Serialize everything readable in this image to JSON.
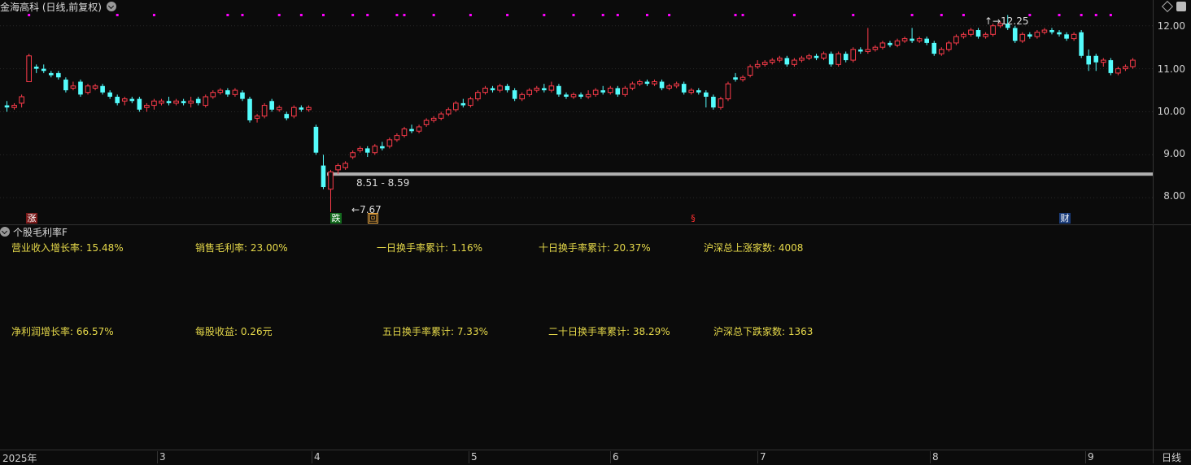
{
  "header": {
    "title": "金海高科 (日线,前复权)"
  },
  "price_axis": {
    "ticks": [
      "12.00",
      "11.00",
      "10.00",
      "9.00",
      "8.00"
    ]
  },
  "annotations": {
    "high_label": "12.25",
    "low_label": "7.67",
    "range_label": "8.51 - 8.59"
  },
  "markers": {
    "m1": "涨",
    "m2": "跌",
    "m3": "回",
    "m4": "§",
    "m5": "财"
  },
  "indicator": {
    "title": "个股毛利率F",
    "row1": [
      "营业收入增长率:  15.48%",
      "销售毛利率: 23.00%",
      "一日换手率累计: 1.16%",
      "十日换手率累计: 20.37%",
      "沪深总上涨家数:  4008"
    ],
    "row2": [
      "净利润增长率:  66.57%",
      "每股收益: 0.26元",
      "五日换手率累计: 7.33%",
      "二十日换手率累计: 38.29%",
      "沪深总下跌家数:  1363"
    ]
  },
  "time_axis": {
    "labels": [
      "2025年",
      "3",
      "4",
      "5",
      "6",
      "7",
      "8",
      "9"
    ],
    "period": "日线"
  },
  "colors": {
    "up": "#ff3c4b",
    "down": "#54fcfc",
    "signal": "#ff00ff",
    "text_yellow": "#e6d94a"
  },
  "chart_data": {
    "type": "candlestick",
    "ylim": [
      7.4,
      12.6
    ],
    "y_ticks": [
      8,
      9,
      10,
      11,
      12
    ],
    "support_level": 8.55,
    "high": 12.25,
    "low": 7.67,
    "candles": [
      [
        10.15,
        10.1,
        10.25,
        10.0
      ],
      [
        10.1,
        10.15,
        10.2,
        10.05
      ],
      [
        10.2,
        10.35,
        10.4,
        10.1
      ],
      [
        10.7,
        11.3,
        11.35,
        10.7
      ],
      [
        11.05,
        11.0,
        11.1,
        10.9
      ],
      [
        11.0,
        10.95,
        11.1,
        10.9
      ],
      [
        10.9,
        10.85,
        10.95,
        10.8
      ],
      [
        10.9,
        10.8,
        10.95,
        10.75
      ],
      [
        10.75,
        10.5,
        10.8,
        10.45
      ],
      [
        10.55,
        10.6,
        10.7,
        10.5
      ],
      [
        10.7,
        10.4,
        10.75,
        10.35
      ],
      [
        10.45,
        10.6,
        10.65,
        10.4
      ],
      [
        10.55,
        10.6,
        10.65,
        10.5
      ],
      [
        10.6,
        10.45,
        10.65,
        10.4
      ],
      [
        10.45,
        10.35,
        10.5,
        10.3
      ],
      [
        10.35,
        10.2,
        10.4,
        10.15
      ],
      [
        10.25,
        10.3,
        10.35,
        10.15
      ],
      [
        10.3,
        10.25,
        10.35,
        10.2
      ],
      [
        10.3,
        10.05,
        10.35,
        10.0
      ],
      [
        10.1,
        10.15,
        10.2,
        10.0
      ],
      [
        10.15,
        10.25,
        10.3,
        10.05
      ],
      [
        10.2,
        10.25,
        10.3,
        10.15
      ],
      [
        10.25,
        10.2,
        10.35,
        10.15
      ],
      [
        10.2,
        10.25,
        10.3,
        10.15
      ],
      [
        10.25,
        10.2,
        10.3,
        10.15
      ],
      [
        10.2,
        10.25,
        10.35,
        10.1
      ],
      [
        10.3,
        10.2,
        10.35,
        10.15
      ],
      [
        10.15,
        10.35,
        10.4,
        10.1
      ],
      [
        10.35,
        10.45,
        10.5,
        10.3
      ],
      [
        10.45,
        10.5,
        10.55,
        10.4
      ],
      [
        10.5,
        10.4,
        10.55,
        10.35
      ],
      [
        10.4,
        10.5,
        10.55,
        10.35
      ],
      [
        10.45,
        10.3,
        10.5,
        10.25
      ],
      [
        10.3,
        9.8,
        10.35,
        9.75
      ],
      [
        9.85,
        9.9,
        9.95,
        9.75
      ],
      [
        9.9,
        10.15,
        10.2,
        9.85
      ],
      [
        10.25,
        10.05,
        10.3,
        10.0
      ],
      [
        10.05,
        10.1,
        10.15,
        10.0
      ],
      [
        9.95,
        9.85,
        10.0,
        9.8
      ],
      [
        9.9,
        10.1,
        10.15,
        9.85
      ],
      [
        10.1,
        10.05,
        10.15,
        10.0
      ],
      [
        10.05,
        10.1,
        10.15,
        10.0
      ],
      [
        9.65,
        9.05,
        9.7,
        9.0
      ],
      [
        8.75,
        8.25,
        9.0,
        8.2
      ],
      [
        8.2,
        8.6,
        8.65,
        7.67
      ],
      [
        8.65,
        8.75,
        8.8,
        8.55
      ],
      [
        8.7,
        8.8,
        8.85,
        8.65
      ],
      [
        8.95,
        9.05,
        9.1,
        8.9
      ],
      [
        9.1,
        9.15,
        9.2,
        9.05
      ],
      [
        9.15,
        9.05,
        9.2,
        8.95
      ],
      [
        9.05,
        9.2,
        9.25,
        9.0
      ],
      [
        9.2,
        9.15,
        9.3,
        9.1
      ],
      [
        9.2,
        9.35,
        9.4,
        9.15
      ],
      [
        9.35,
        9.45,
        9.5,
        9.3
      ],
      [
        9.45,
        9.6,
        9.65,
        9.4
      ],
      [
        9.6,
        9.55,
        9.7,
        9.5
      ],
      [
        9.55,
        9.65,
        9.7,
        9.5
      ],
      [
        9.7,
        9.8,
        9.85,
        9.65
      ],
      [
        9.8,
        9.85,
        9.9,
        9.75
      ],
      [
        9.85,
        9.95,
        10.0,
        9.8
      ],
      [
        9.95,
        10.05,
        10.1,
        9.9
      ],
      [
        10.05,
        10.2,
        10.25,
        10.0
      ],
      [
        10.2,
        10.15,
        10.3,
        10.1
      ],
      [
        10.15,
        10.3,
        10.35,
        10.1
      ],
      [
        10.3,
        10.45,
        10.5,
        10.25
      ],
      [
        10.45,
        10.55,
        10.6,
        10.4
      ],
      [
        10.55,
        10.5,
        10.6,
        10.45
      ],
      [
        10.5,
        10.6,
        10.65,
        10.45
      ],
      [
        10.6,
        10.5,
        10.65,
        10.45
      ],
      [
        10.5,
        10.3,
        10.55,
        10.25
      ],
      [
        10.3,
        10.4,
        10.45,
        10.25
      ],
      [
        10.4,
        10.5,
        10.55,
        10.35
      ],
      [
        10.5,
        10.55,
        10.6,
        10.45
      ],
      [
        10.55,
        10.5,
        10.65,
        10.45
      ],
      [
        10.5,
        10.6,
        10.7,
        10.45
      ],
      [
        10.6,
        10.4,
        10.65,
        10.35
      ],
      [
        10.4,
        10.35,
        10.45,
        10.3
      ],
      [
        10.35,
        10.4,
        10.45,
        10.3
      ],
      [
        10.4,
        10.35,
        10.45,
        10.3
      ],
      [
        10.35,
        10.4,
        10.5,
        10.3
      ],
      [
        10.4,
        10.5,
        10.55,
        10.35
      ],
      [
        10.5,
        10.45,
        10.6,
        10.4
      ],
      [
        10.45,
        10.55,
        10.6,
        10.4
      ],
      [
        10.55,
        10.4,
        10.6,
        10.35
      ],
      [
        10.4,
        10.55,
        10.6,
        10.35
      ],
      [
        10.55,
        10.65,
        10.7,
        10.5
      ],
      [
        10.65,
        10.7,
        10.75,
        10.6
      ],
      [
        10.7,
        10.65,
        10.75,
        10.6
      ],
      [
        10.65,
        10.7,
        10.75,
        10.6
      ],
      [
        10.7,
        10.55,
        10.75,
        10.5
      ],
      [
        10.55,
        10.6,
        10.65,
        10.5
      ],
      [
        10.6,
        10.65,
        10.7,
        10.55
      ],
      [
        10.65,
        10.45,
        10.7,
        10.4
      ],
      [
        10.45,
        10.5,
        10.55,
        10.4
      ],
      [
        10.5,
        10.45,
        10.55,
        10.4
      ],
      [
        10.45,
        10.35,
        10.5,
        10.1
      ],
      [
        10.35,
        10.1,
        10.4,
        10.05
      ],
      [
        10.1,
        10.3,
        10.35,
        10.05
      ],
      [
        10.3,
        10.65,
        10.7,
        10.25
      ],
      [
        10.8,
        10.75,
        10.9,
        10.7
      ],
      [
        10.75,
        10.8,
        10.85,
        10.7
      ],
      [
        10.85,
        11.05,
        11.1,
        10.8
      ],
      [
        11.05,
        11.1,
        11.2,
        11.0
      ],
      [
        11.1,
        11.15,
        11.2,
        11.05
      ],
      [
        11.15,
        11.2,
        11.25,
        11.1
      ],
      [
        11.2,
        11.25,
        11.3,
        11.15
      ],
      [
        11.25,
        11.1,
        11.3,
        11.05
      ],
      [
        11.1,
        11.2,
        11.25,
        11.05
      ],
      [
        11.2,
        11.25,
        11.3,
        11.15
      ],
      [
        11.25,
        11.3,
        11.35,
        11.2
      ],
      [
        11.3,
        11.25,
        11.35,
        11.2
      ],
      [
        11.25,
        11.35,
        11.4,
        11.2
      ],
      [
        11.35,
        11.1,
        11.4,
        11.05
      ],
      [
        11.1,
        11.35,
        11.4,
        11.05
      ],
      [
        11.35,
        11.2,
        11.4,
        11.15
      ],
      [
        11.2,
        11.45,
        11.5,
        11.15
      ],
      [
        11.45,
        11.4,
        11.5,
        11.35
      ],
      [
        11.4,
        11.45,
        11.95,
        11.35
      ],
      [
        11.45,
        11.5,
        11.55,
        11.4
      ],
      [
        11.5,
        11.6,
        11.65,
        11.45
      ],
      [
        11.6,
        11.55,
        11.65,
        11.5
      ],
      [
        11.55,
        11.65,
        11.7,
        11.5
      ],
      [
        11.65,
        11.7,
        11.75,
        11.6
      ],
      [
        11.7,
        11.65,
        11.95,
        11.6
      ],
      [
        11.65,
        11.7,
        11.75,
        11.6
      ],
      [
        11.7,
        11.6,
        11.75,
        11.55
      ],
      [
        11.6,
        11.35,
        11.65,
        11.3
      ],
      [
        11.35,
        11.45,
        11.5,
        11.3
      ],
      [
        11.45,
        11.6,
        11.65,
        11.4
      ],
      [
        11.6,
        11.75,
        11.8,
        11.55
      ],
      [
        11.75,
        11.8,
        11.85,
        11.7
      ],
      [
        11.8,
        11.9,
        11.95,
        11.75
      ],
      [
        11.9,
        11.75,
        11.95,
        11.7
      ],
      [
        11.75,
        11.8,
        11.85,
        11.7
      ],
      [
        11.8,
        12.0,
        12.05,
        11.75
      ],
      [
        12.0,
        12.05,
        12.1,
        11.95
      ],
      [
        12.05,
        11.95,
        12.25,
        11.9
      ],
      [
        11.95,
        11.65,
        12.0,
        11.6
      ],
      [
        11.65,
        11.8,
        11.85,
        11.6
      ],
      [
        11.8,
        11.75,
        11.85,
        11.7
      ],
      [
        11.75,
        11.85,
        11.9,
        11.7
      ],
      [
        11.85,
        11.9,
        11.95,
        11.8
      ],
      [
        11.9,
        11.85,
        11.95,
        11.8
      ],
      [
        11.85,
        11.8,
        11.9,
        11.75
      ],
      [
        11.8,
        11.7,
        11.85,
        11.65
      ],
      [
        11.7,
        11.8,
        11.85,
        11.65
      ],
      [
        11.85,
        11.3,
        11.9,
        11.25
      ],
      [
        11.3,
        11.1,
        11.45,
        10.95
      ],
      [
        11.3,
        11.15,
        11.35,
        10.95
      ],
      [
        11.15,
        11.2,
        11.25,
        11.05
      ],
      [
        11.2,
        10.9,
        11.25,
        10.85
      ],
      [
        10.9,
        11.0,
        11.05,
        10.85
      ],
      [
        11.0,
        11.05,
        11.1,
        10.95
      ],
      [
        11.05,
        11.2,
        11.25,
        11.0
      ]
    ]
  }
}
